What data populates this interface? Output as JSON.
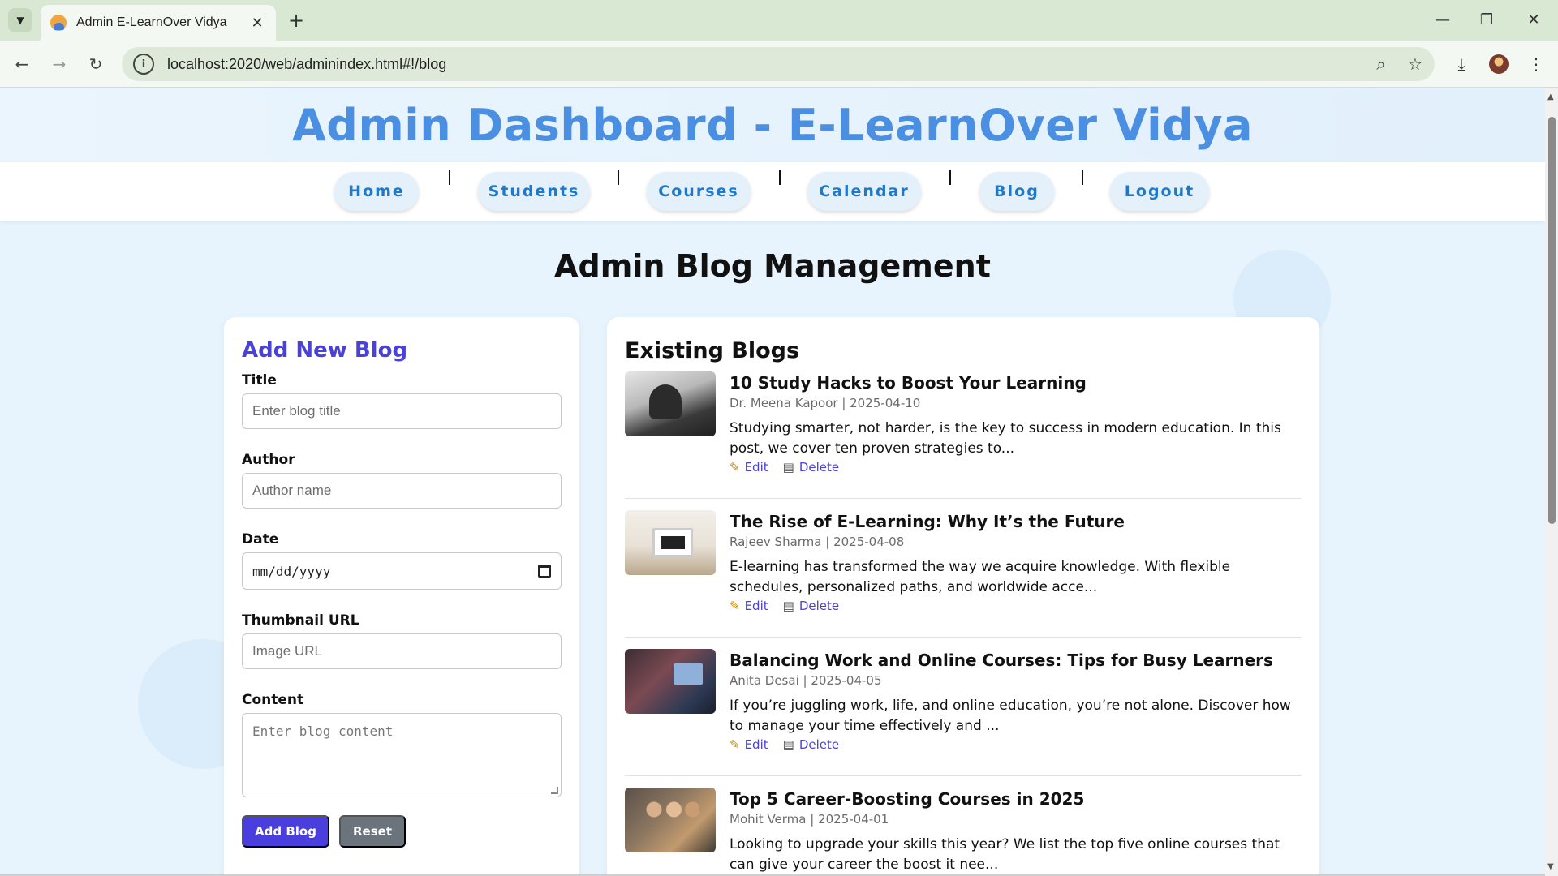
{
  "browser": {
    "tab_title": "Admin E-LearnOver Vidya",
    "url": "localhost:2020/web/adminindex.html#!/blog"
  },
  "header": {
    "title": "Admin Dashboard - E-LearnOver Vidya"
  },
  "nav": {
    "items": [
      {
        "label": "Home"
      },
      {
        "label": "Students"
      },
      {
        "label": "Courses"
      },
      {
        "label": "Calendar"
      },
      {
        "label": "Blog"
      },
      {
        "label": "Logout"
      }
    ]
  },
  "page": {
    "heading": "Admin Blog Management"
  },
  "form": {
    "title": "Add New Blog",
    "title_label": "Title",
    "title_placeholder": "Enter blog title",
    "author_label": "Author",
    "author_placeholder": "Author name",
    "date_label": "Date",
    "date_placeholder": "mm/dd/yyyy",
    "thumbnail_label": "Thumbnail URL",
    "thumbnail_placeholder": "Image URL",
    "content_label": "Content",
    "content_placeholder": "Enter blog content",
    "add_button": "Add Blog",
    "reset_button": "Reset"
  },
  "blogs": {
    "title": "Existing Blogs",
    "edit_label": "Edit",
    "delete_label": "Delete",
    "items": [
      {
        "title": "10 Study Hacks to Boost Your Learning",
        "meta": "Dr. Meena Kapoor | 2025-04-10",
        "excerpt": "Studying smarter, not harder, is the key to success in modern education. In this post, we cover ten proven strategies to..."
      },
      {
        "title": "The Rise of E-Learning: Why It’s the Future",
        "meta": "Rajeev Sharma | 2025-04-08",
        "excerpt": "E-learning has transformed the way we acquire knowledge. With flexible schedules, personalized paths, and worldwide acce..."
      },
      {
        "title": "Balancing Work and Online Courses: Tips for Busy Learners",
        "meta": "Anita Desai | 2025-04-05",
        "excerpt": "If you’re juggling work, life, and online education, you’re not alone. Discover how to manage your time effectively and ..."
      },
      {
        "title": "Top 5 Career-Boosting Courses in 2025",
        "meta": "Mohit Verma | 2025-04-01",
        "excerpt": "Looking to upgrade your skills this year? We list the top five online courses that can give your career the boost it nee..."
      }
    ]
  }
}
